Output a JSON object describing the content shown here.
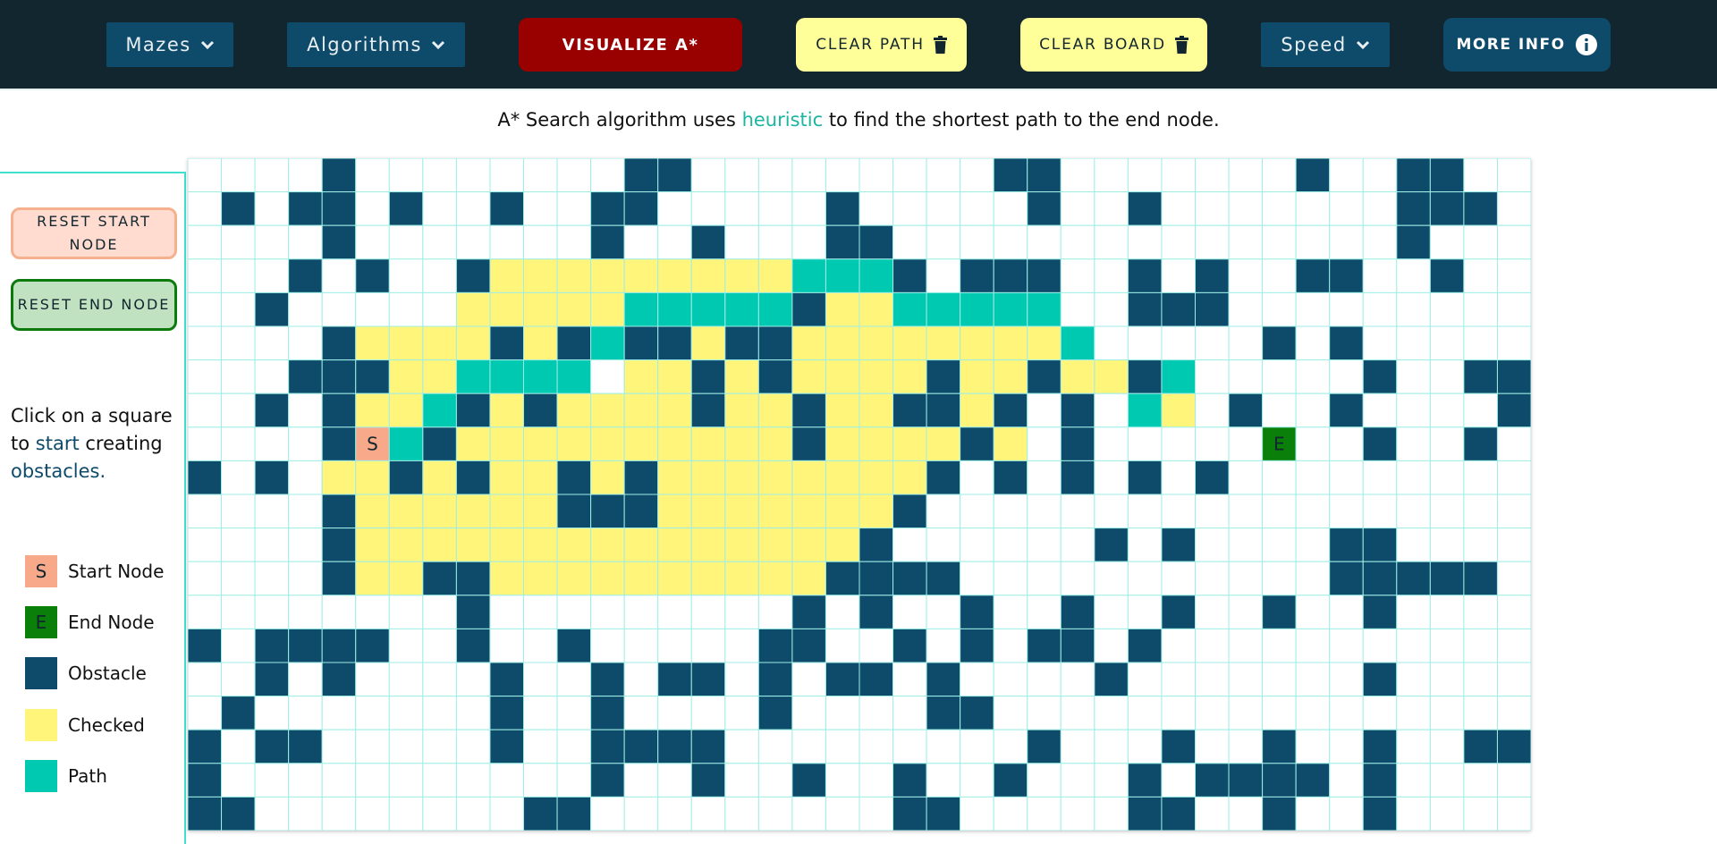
{
  "nav": {
    "mazes": "Mazes",
    "algorithms": "Algorithms",
    "visualize": "VISUALIZE A*",
    "clear_path": "CLEAR PATH",
    "clear_board": "CLEAR BOARD",
    "speed": "Speed",
    "more_info": "MORE INFO"
  },
  "description": {
    "before": "A* Search algorithm uses",
    "highlight": "heuristic",
    "after": "to find the shortest path to the end node."
  },
  "sidebar": {
    "reset_start": "RESET START NODE",
    "reset_end": "RESET END NODE",
    "hint_part1": "Click on a square to",
    "hint_highlight1": "start",
    "hint_part2": "creating",
    "hint_highlight2": "obstacles.",
    "legend": [
      {
        "symbol": "S",
        "label": "Start Node",
        "color": "#f8a98a"
      },
      {
        "symbol": "E",
        "label": "End Node",
        "color": "#0a7f0a"
      },
      {
        "symbol": "",
        "label": "Obstacle",
        "color": "#0e4b6b"
      },
      {
        "symbol": "",
        "label": "Checked",
        "color": "#fff57a"
      },
      {
        "symbol": "",
        "label": "Path",
        "color": "#00c9b2"
      }
    ]
  },
  "grid": {
    "cols": 40,
    "rows": 20,
    "start_label": "S",
    "end_label": "E",
    "colors": {
      "empty": "#ffffff",
      "line": "#9feee6",
      "obstacle": "#0e4b6b",
      "checked": "#fff57a",
      "path": "#00c9b2",
      "start": "#f8a98a",
      "end": "#0a7f0a"
    },
    "cell_legend": {
      ".": "empty",
      "#": "obstacle",
      "c": "checked",
      "p": "path",
      "S": "start",
      "E": "end"
    },
    "rows_data": [
      "....#........##.........##.......#..##..",
      ".#.##.#..#..##.....#.....#..#.......###.",
      "....#.......#..#...##...............#...",
      "...#.#..#cccccccccppp#.###..#.#..##..#..",
      "..#.....cccccppppp#ccppppp..###.........",
      "....#cccc#c#p##c##ccccccccp.....#.#.....",
      "...###ccpppp.cc#c#cccc#cc#cc#p.....#..###",
      "..#.#ccp#c#cccc#cc#cc##c#.#.pc.#..#....#",
      "....#Sp#cccccccccc#cccc#c.#.....E..#..#..",
      "#.#.cc#c#cc#c#cccccccc#.#.#.#.#.........",
      "....#cccccc###ccccccc#..................#",
      "....#ccccccccccccccc#......#.#....##.....",
      "....#cc##cccccccccc####...........#####..",
      "........#.........#.#..#..#..#..#..#....",
      "#.####..#..#.....##..#.#.##.#...........#",
      "..#.#....#..#.##.#.##.#....#.......#....",
      ".#.......#..#....#....##................#",
      "#.##.....#..####.........#...#..#..#..##",
      "#...........#..#..#..#..#...#.####.#....",
      "##........##.........##.....##..#..#....#"
    ]
  }
}
